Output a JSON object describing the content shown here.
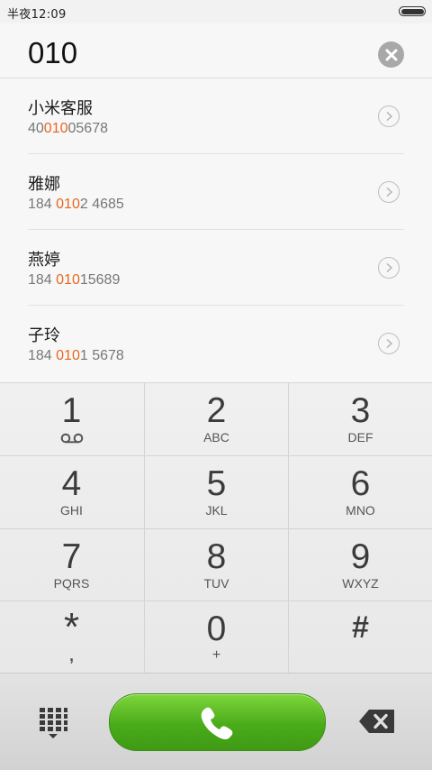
{
  "status_bar": {
    "time": "半夜12:09",
    "battery_icon": "battery-icon"
  },
  "dial_input": {
    "value": "010",
    "clear_icon": "clear-icon"
  },
  "results": [
    {
      "name": "小米客服",
      "number_before": "40",
      "number_match": "010",
      "number_after": "05678"
    },
    {
      "name": "雅娜",
      "number_before": "184 ",
      "number_match": "010",
      "number_after": "2 4685"
    },
    {
      "name": "燕婷",
      "number_before": "184 ",
      "number_match": "010",
      "number_after": "15689"
    },
    {
      "name": "子玲",
      "number_before": "184 ",
      "number_match": "010",
      "number_after": "1 5678"
    }
  ],
  "keypad": {
    "keys": [
      {
        "digit": "1",
        "letters": ""
      },
      {
        "digit": "2",
        "letters": "ABC"
      },
      {
        "digit": "3",
        "letters": "DEF"
      },
      {
        "digit": "4",
        "letters": "GHI"
      },
      {
        "digit": "5",
        "letters": "JKL"
      },
      {
        "digit": "6",
        "letters": "MNO"
      },
      {
        "digit": "7",
        "letters": "PQRS"
      },
      {
        "digit": "8",
        "letters": "TUV"
      },
      {
        "digit": "9",
        "letters": "WXYZ"
      },
      {
        "digit": "*",
        "letters": ","
      },
      {
        "digit": "0",
        "letters": "+"
      },
      {
        "digit": "#",
        "letters": ""
      }
    ]
  },
  "bottom_bar": {
    "keypad_toggle_icon": "dialpad-icon",
    "call_icon": "phone-icon",
    "backspace_icon": "backspace-icon"
  },
  "colors": {
    "highlight": "#e8671e",
    "call_green": "#4aab1a"
  }
}
